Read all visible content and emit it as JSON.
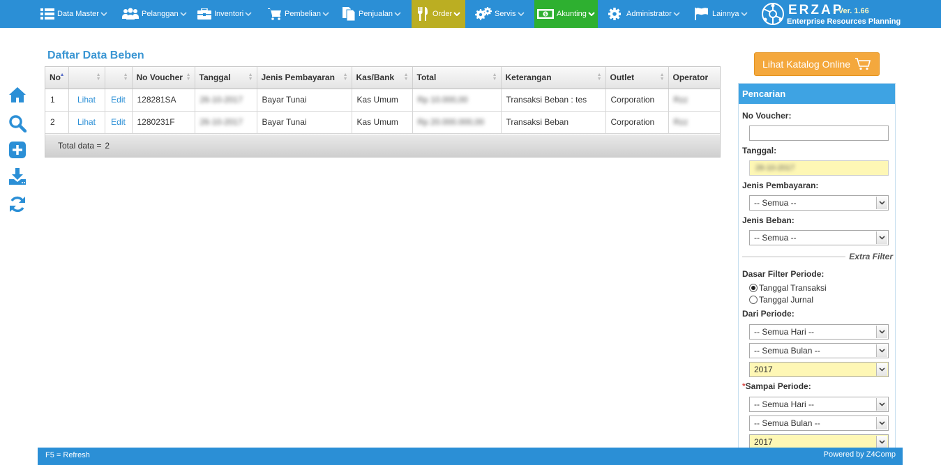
{
  "nav": {
    "items": [
      {
        "label": "Data Master",
        "icon": "list-icon"
      },
      {
        "label": "Pelanggan",
        "icon": "users-icon"
      },
      {
        "label": "Inventori",
        "icon": "briefcase-icon"
      },
      {
        "label": "Pembelian",
        "icon": "cart-icon"
      },
      {
        "label": "Penjualan",
        "icon": "documents-icon"
      },
      {
        "label": "Order",
        "icon": "utensils-icon"
      },
      {
        "label": "Servis",
        "icon": "gears-icon"
      },
      {
        "label": "Akunting",
        "icon": "money-icon"
      },
      {
        "label": "Administrator",
        "icon": "gear-icon"
      },
      {
        "label": "Lainnya",
        "icon": "flag-icon"
      }
    ],
    "colors": {
      "bar": "#2b8fd6",
      "order": "#bbae22",
      "akunting": "#2eb030"
    }
  },
  "brand": {
    "logo_text": "ERZAP",
    "version": "- Ver. 1.66",
    "subtitle": "Enterprise Resources Planning"
  },
  "page": {
    "title": "Daftar Data Beben"
  },
  "table": {
    "headers": [
      "No",
      "",
      "",
      "No Voucher",
      "Tanggal",
      "Jenis Pembayaran",
      "Kas/Bank",
      "Total",
      "Keterangan",
      "Outlet",
      "Operator"
    ],
    "rows": [
      {
        "no": "1",
        "view": "Lihat",
        "edit": "Edit",
        "voucher": "128281SA",
        "tanggal": "26-10-2017",
        "jenis": "Bayar Tunai",
        "kas": "Kas Umum",
        "total": "Rp 10.000,00",
        "keterangan": "Transaksi Beban : tes",
        "outlet": "Corporation",
        "operator": "Rzz"
      },
      {
        "no": "2",
        "view": "Lihat",
        "edit": "Edit",
        "voucher": "1280231F",
        "tanggal": "26-10-2017",
        "jenis": "Bayar Tunai",
        "kas": "Kas Umum",
        "total": "Rp 20.000.000,00",
        "keterangan": "Transaksi Beban",
        "outlet": "Corporation",
        "operator": "Rzz"
      }
    ],
    "total_label": "Total data =",
    "total_value": "2"
  },
  "catalog_button": "Lihat Katalog Online",
  "search": {
    "title": "Pencarian",
    "no_voucher_label": "No Voucher:",
    "no_voucher_value": "",
    "tanggal_label": "Tanggal:",
    "tanggal_value": "26-10-2017",
    "jenis_pembayaran_label": "Jenis Pembayaran:",
    "jenis_pembayaran_value": "-- Semua --",
    "jenis_beban_label": "Jenis Beban:",
    "jenis_beban_value": "-- Semua --",
    "extra_filter": "Extra Filter",
    "dasar_label": "Dasar Filter Periode:",
    "radio_transaksi": "Tanggal Transaksi",
    "radio_jurnal": "Tanggal Jurnal",
    "dari_label": "Dari Periode:",
    "dari_hari": "-- Semua Hari --",
    "dari_bulan": "-- Semua Bulan --",
    "dari_tahun": "2017",
    "sampai_label": "Sampai Periode:",
    "sampai_hari": "-- Semua Hari --",
    "sampai_bulan": "-- Semua Bulan --",
    "sampai_tahun": "2017"
  },
  "footer": {
    "left": "F5 = Refresh",
    "right": "Powered by Z4Comp"
  }
}
